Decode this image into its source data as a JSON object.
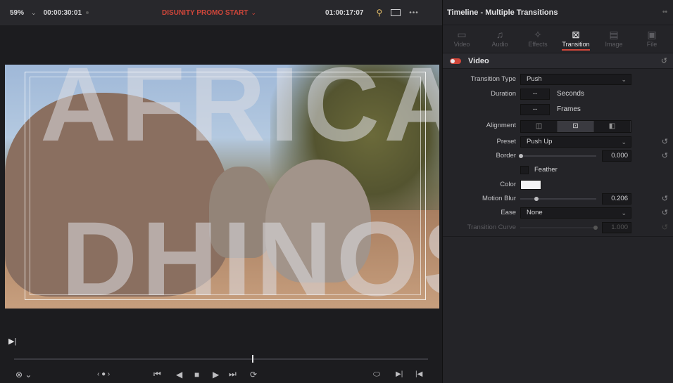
{
  "viewer": {
    "zoom": "59%",
    "zoom_chevron": "⌄",
    "source_timecode": "00:00:30:01",
    "clip_name": "DISUNITY PROMO START",
    "clip_chevron": "⌄",
    "record_timecode": "01:00:17:07",
    "more": "•••",
    "overlay_line1": "AFRICA'S",
    "overlay_line2": "DHINOS",
    "mark_glyph": "▶|",
    "transport": {
      "options_icon": "⊗ ⌄",
      "jog": "‹ ● ›",
      "first_frame": "⏮",
      "reverse": "◀",
      "stop": "■",
      "play": "▶",
      "last_frame": "⏭",
      "loop": "⟳",
      "match_frame": "⬭",
      "mark_in": "▶|",
      "mark_out": "|◀"
    }
  },
  "inspector": {
    "title": "Timeline - Multiple Transitions",
    "more": "••",
    "tabs": [
      {
        "label": "Video",
        "icon": "▭"
      },
      {
        "label": "Audio",
        "icon": "♫"
      },
      {
        "label": "Effects",
        "icon": "✧"
      },
      {
        "label": "Transition",
        "icon": "⊠"
      },
      {
        "label": "Image",
        "icon": "▤"
      },
      {
        "label": "File",
        "icon": "▣"
      }
    ],
    "section": {
      "label": "Video",
      "reset": "↺"
    },
    "rows": {
      "transition_type": {
        "label": "Transition Type",
        "value": "Push",
        "chevron": "⌄"
      },
      "duration": {
        "label": "Duration",
        "seconds_value": "--",
        "seconds_unit": "Seconds",
        "frames_value": "--",
        "frames_unit": "Frames"
      },
      "alignment": {
        "label": "Alignment",
        "options": [
          "◫",
          "⊡",
          "◧"
        ],
        "selected": 1
      },
      "preset": {
        "label": "Preset",
        "value": "Push Up",
        "chevron": "⌄"
      },
      "border": {
        "label": "Border",
        "value": "0.000",
        "slider": 0.0
      },
      "feather": {
        "label": "Feather"
      },
      "color": {
        "label": "Color",
        "swatch": "#f4f4f4"
      },
      "motion_blur": {
        "label": "Motion Blur",
        "value": "0.206",
        "slider": 0.21
      },
      "ease": {
        "label": "Ease",
        "value": "None",
        "chevron": "⌄"
      },
      "transition_curve": {
        "label": "Transition Curve",
        "value": "1.000",
        "slider": 1.0
      }
    },
    "reset_icon": "↺"
  },
  "colors": {
    "accent": "#d0463a",
    "panel": "#242428",
    "field": "#1a1a1d"
  }
}
